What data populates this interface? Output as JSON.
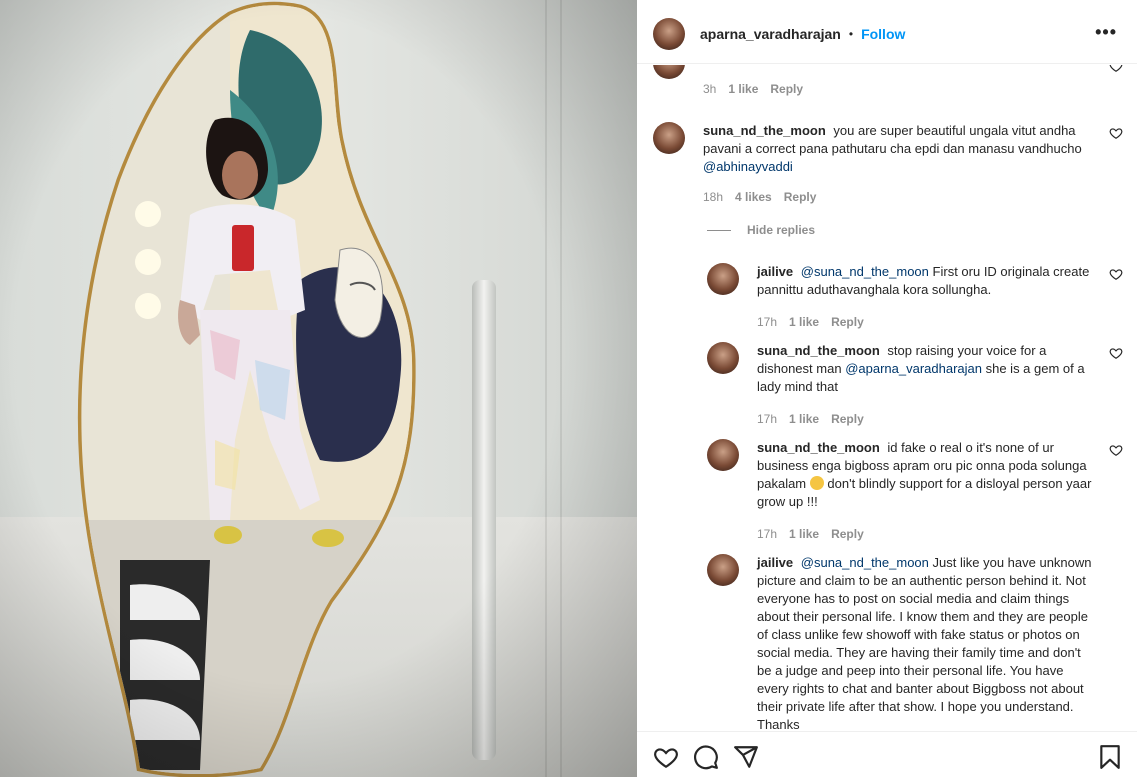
{
  "header": {
    "username": "aparna_varadharajan",
    "separator": "•",
    "follow_label": "Follow",
    "more_label": "•••"
  },
  "comments": {
    "first_meta": {
      "time": "3h",
      "likes": "1 like",
      "reply": "Reply"
    },
    "main": {
      "user": "suna_nd_the_moon",
      "text": "you are super beautiful ungala vitut andha pavani a correct pana pathutaru cha epdi dan manasu vandhucho",
      "mention": "@abhinayvaddi",
      "time": "18h",
      "likes": "4 likes",
      "reply": "Reply"
    },
    "hide_replies": "Hide replies",
    "replies": [
      {
        "user": "jailive",
        "mention": "@suna_nd_the_moon",
        "text": "First oru ID originala create pannittu aduthavanghala kora sollungha.",
        "time": "17h",
        "likes": "1 like",
        "reply": "Reply"
      },
      {
        "user": "suna_nd_the_moon",
        "text_a": "stop raising your voice for a dishonest man",
        "mention": "@aparna_varadharajan",
        "text_b": "she is a gem of a lady mind that",
        "time": "17h",
        "likes": "1 like",
        "reply": "Reply"
      },
      {
        "user": "suna_nd_the_moon",
        "text_a": "id fake o real o it's none of ur business enga bigboss apram oru pic onna poda solunga pakalam",
        "text_b": "don't blindly support for a disloyal person yaar grow up !!!",
        "time": "17h",
        "likes": "1 like",
        "reply": "Reply"
      },
      {
        "user": "jailive",
        "mention": "@suna_nd_the_moon",
        "text": "Just like you have unknown picture and claim to be an authentic person behind it. Not everyone has to post on social media and claim things about their personal life. I know them and they are people of class unlike few showoff with fake status or photos on social media. They are having their family time and don't be a judge and peep into their personal life. You have every rights to chat and banter about Biggboss not about their private life after that show. I hope you understand. Thanks"
      }
    ]
  },
  "icons": {
    "like": "heart-icon",
    "comment": "comment-icon",
    "share": "share-icon",
    "save": "bookmark-icon"
  },
  "colors": {
    "follow": "#0095f6",
    "mention": "#00376b",
    "meta": "#8e8e8e"
  }
}
